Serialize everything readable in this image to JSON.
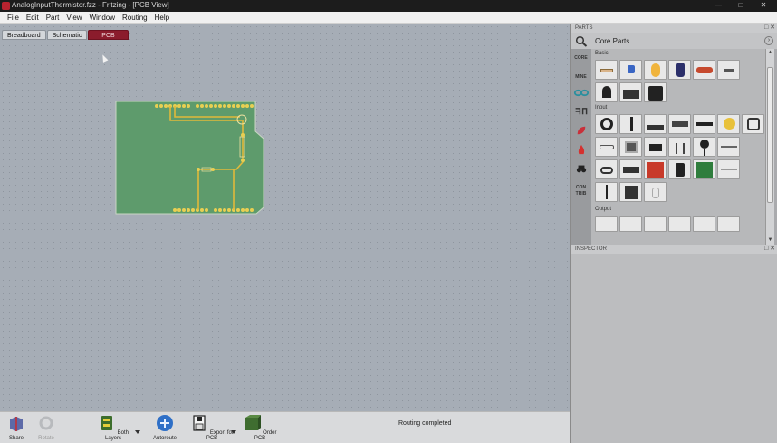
{
  "window": {
    "title": "AnalogInputThermistor.fzz - Fritzing - [PCB View]",
    "min": "—",
    "max": "□",
    "close": "✕"
  },
  "menu": [
    "File",
    "Edit",
    "Part",
    "View",
    "Window",
    "Routing",
    "Help"
  ],
  "view_tabs": [
    "Breadboard",
    "Schematic",
    "PCB"
  ],
  "toolbar": {
    "share": "Share",
    "rotate": "Rotate",
    "both_layers": "Both Layers",
    "autoroute": "Autoroute",
    "export": "Export for PCB",
    "order": "Order PCB",
    "status": "Routing completed"
  },
  "parts_panel": {
    "title": "PARTS",
    "bin_title": "Core Parts",
    "bins": [
      "CORE",
      "MINE",
      "",
      "",
      "",
      "",
      "",
      "CON TRIB"
    ],
    "sections": [
      "Basic",
      "Input",
      "Output"
    ],
    "controls": "□ ✕"
  },
  "inspector": {
    "title": "INSPECTOR",
    "controls": "□ ✕"
  },
  "colors": {
    "pcb_board": "#5e9b6c",
    "trace": "#e0b93a",
    "active_tab": "#8b1c2c",
    "canvas": "#a6adb6"
  },
  "icons": [
    "search-icon",
    "share-icon",
    "rotate-icon",
    "layers-icon",
    "autoroute-icon",
    "export-icon",
    "order-icon"
  ]
}
